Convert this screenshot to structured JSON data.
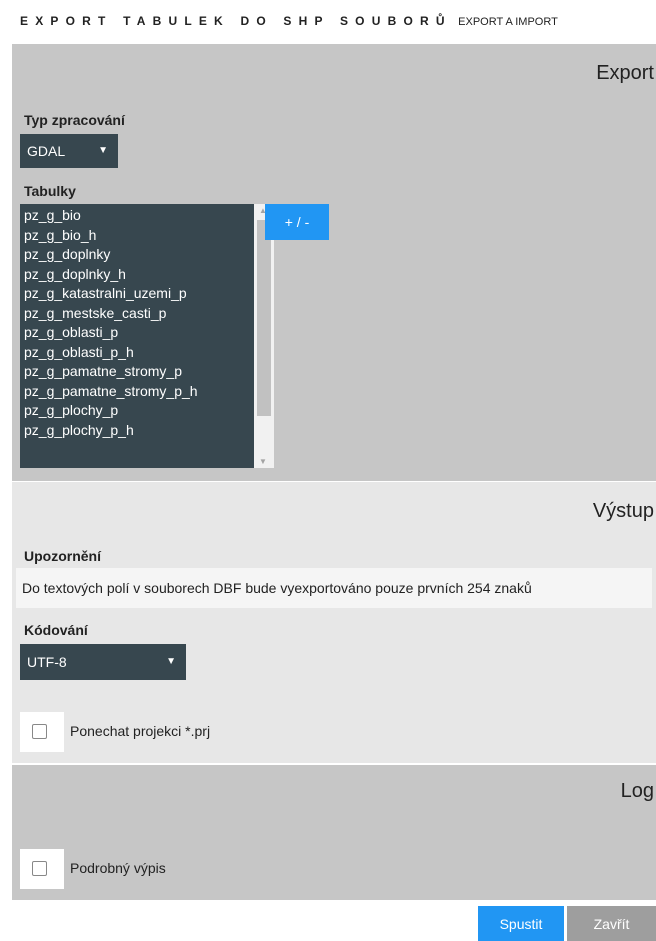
{
  "header": {
    "title": "EXPORT TABULEK DO SHP SOUBORŮ",
    "subtitle": "EXPORT A IMPORT"
  },
  "export": {
    "title": "Export",
    "processing_label": "Typ zpracování",
    "processing_value": "GDAL",
    "tables_label": "Tabulky",
    "tables": [
      "pz_g_bio",
      "pz_g_bio_h",
      "pz_g_doplnky",
      "pz_g_doplnky_h",
      "pz_g_katastralni_uzemi_p",
      "pz_g_mestske_casti_p",
      "pz_g_oblasti_p",
      "pz_g_oblasti_p_h",
      "pz_g_pamatne_stromy_p",
      "pz_g_pamatne_stromy_p_h",
      "pz_g_plochy_p",
      "pz_g_plochy_p_h"
    ],
    "toggle_label": "+ / -"
  },
  "vystup": {
    "title": "Výstup",
    "warning_label": "Upozornění",
    "warning_text": "Do textových polí v souborech DBF bude vyexportováno pouze prvních 254 znaků",
    "encoding_label": "Kódování",
    "encoding_value": "UTF-8",
    "keep_projection_label": "Ponechat projekci *.prj"
  },
  "log": {
    "title": "Log",
    "verbose_label": "Podrobný výpis"
  },
  "footer": {
    "run_label": "Spustit",
    "close_label": "Zavřít"
  },
  "colors": {
    "accent": "#2196f3",
    "dark_control": "#37474f",
    "section_gray": "#c6c6c6",
    "section_light": "#e7e7e7"
  },
  "icons": {
    "dropdown": "caret-down-icon",
    "scroll_up": "scroll-up-arrow-icon",
    "scroll_down": "scroll-down-arrow-icon"
  }
}
